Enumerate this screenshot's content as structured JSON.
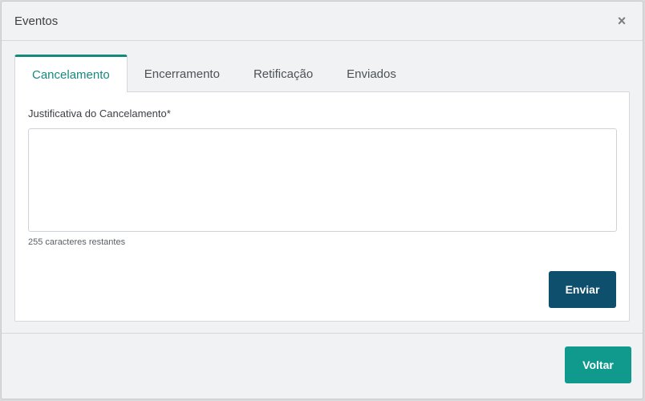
{
  "modal": {
    "title": "Eventos",
    "close_glyph": "×"
  },
  "tabs": [
    {
      "label": "Cancelamento",
      "active": true
    },
    {
      "label": "Encerramento",
      "active": false
    },
    {
      "label": "Retificação",
      "active": false
    },
    {
      "label": "Enviados",
      "active": false
    }
  ],
  "form": {
    "label": "Justificativa do Cancelamento*",
    "value": "",
    "counter_text": "255 caracteres restantes",
    "send_label": "Enviar"
  },
  "footer": {
    "back_label": "Voltar"
  },
  "colors": {
    "accent": "#16897e",
    "send_button": "#0e4f6e",
    "back_button": "#0f9a8d"
  }
}
